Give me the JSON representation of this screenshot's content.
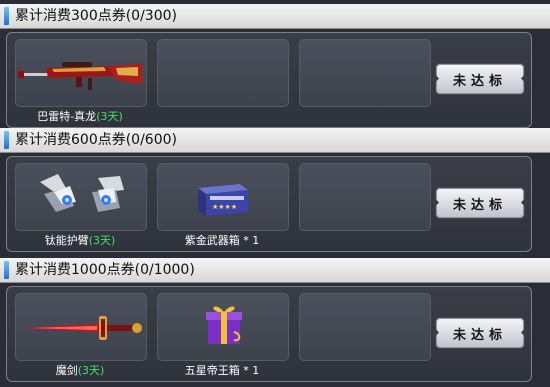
{
  "tiers": [
    {
      "title": "累计消费300点券(0/300)",
      "status": "未达标",
      "rewards": [
        {
          "icon": "sniper-rifle-icon",
          "name": "巴雷特-真龙",
          "duration": "(3天)"
        }
      ]
    },
    {
      "title": "累计消费600点券(0/600)",
      "status": "未达标",
      "rewards": [
        {
          "icon": "armguard-icon",
          "name": "钛能护臂",
          "duration": "(3天)"
        },
        {
          "icon": "weapon-box-icon",
          "name": "紫金武器箱 * 1",
          "duration": ""
        }
      ]
    },
    {
      "title": "累计消费1000点券(0/1000)",
      "status": "未达标",
      "rewards": [
        {
          "icon": "sword-icon",
          "name": "魔剑",
          "duration": "(3天)"
        },
        {
          "icon": "gift-box-icon",
          "name": "五星帝王箱 * 1",
          "duration": ""
        }
      ]
    }
  ],
  "colors": {
    "duration": "#45e06b",
    "marker": "#2a8cf0",
    "button": "#dfe1e5"
  }
}
